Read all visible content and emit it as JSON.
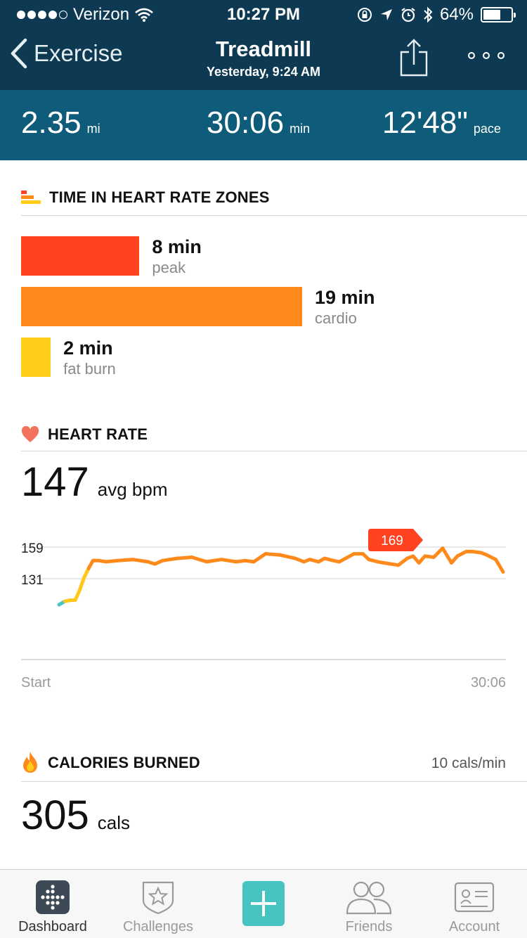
{
  "status_bar": {
    "carrier": "Verizon",
    "time": "10:27 PM",
    "battery": "64%",
    "battery_level": 0.64
  },
  "nav": {
    "back_label": "Exercise",
    "title": "Treadmill",
    "subtitle": "Yesterday, 9:24 AM"
  },
  "stats": [
    {
      "value": "2.35",
      "unit": "mi"
    },
    {
      "value": "30:06",
      "unit": "min"
    },
    {
      "value": "12'48\"",
      "unit": "pace"
    }
  ],
  "zones": {
    "title": "TIME IN HEART RATE ZONES",
    "items": [
      {
        "value": "8 min",
        "label": "peak",
        "minutes": 8,
        "color": "#ff4220"
      },
      {
        "value": "19 min",
        "label": "cardio",
        "minutes": 19,
        "color": "#ff8a1c"
      },
      {
        "value": "2 min",
        "label": "fat burn",
        "minutes": 2,
        "color": "#ffcc1a"
      }
    ]
  },
  "heart_rate": {
    "title": "HEART RATE",
    "avg": "147",
    "avg_unit": "avg bpm",
    "peak_label": "169",
    "y_labels": [
      "159",
      "131"
    ],
    "start_label": "Start",
    "end_label": "30:06"
  },
  "chart_data": {
    "type": "line",
    "x_range": [
      0,
      30.1
    ],
    "y_ticks": [
      131,
      159
    ],
    "series": [
      {
        "x": [
          0,
          0.4,
          0.8,
          1.1,
          1.4,
          1.7,
          2.0,
          2.3,
          2.7,
          3.2,
          4.0,
          5.0,
          6.0,
          6.5,
          7.0,
          8.0,
          9.0,
          10.0,
          11.0,
          12.0,
          12.6,
          13.2,
          14.0,
          15.0,
          16.0,
          16.6,
          17.0,
          17.6,
          18.0,
          18.6,
          19.0,
          20.0,
          20.6,
          21.0,
          21.6,
          22.0,
          23.0,
          23.6,
          24.0,
          24.4,
          24.8,
          25.4,
          26.0,
          26.6,
          27.0,
          27.6,
          28.0,
          28.6,
          29.0,
          29.6,
          30.1
        ],
        "y": [
          108,
          111,
          112,
          112,
          121,
          132,
          140,
          147,
          147,
          146,
          147,
          148,
          146,
          144,
          147,
          149,
          150,
          146,
          148,
          146,
          147,
          146,
          153,
          152,
          149,
          146,
          148,
          146,
          149,
          147,
          146,
          153,
          153,
          148,
          146,
          145,
          143,
          149,
          151,
          145,
          151,
          150,
          158,
          145,
          151,
          155,
          155,
          154,
          152,
          148,
          137
        ]
      }
    ]
  },
  "calories": {
    "title": "CALORIES BURNED",
    "rate": "10 cals/min",
    "value": "305",
    "unit": "cals"
  },
  "tabs": [
    {
      "label": "Dashboard",
      "icon": "dashboard-icon",
      "active": true
    },
    {
      "label": "Challenges",
      "icon": "star-badge-icon",
      "active": false
    },
    {
      "label": "",
      "icon": "plus-icon",
      "active": false
    },
    {
      "label": "Friends",
      "icon": "friends-icon",
      "active": false
    },
    {
      "label": "Account",
      "icon": "account-card-icon",
      "active": false
    }
  ],
  "colors": {
    "header": "#0d3a52",
    "stats_bar": "#0e5c79",
    "accent_teal": "#47c3c2",
    "line_orange": "#ff8a1c",
    "line_yellow": "#ffc71a",
    "peak_red": "#ff4220"
  }
}
